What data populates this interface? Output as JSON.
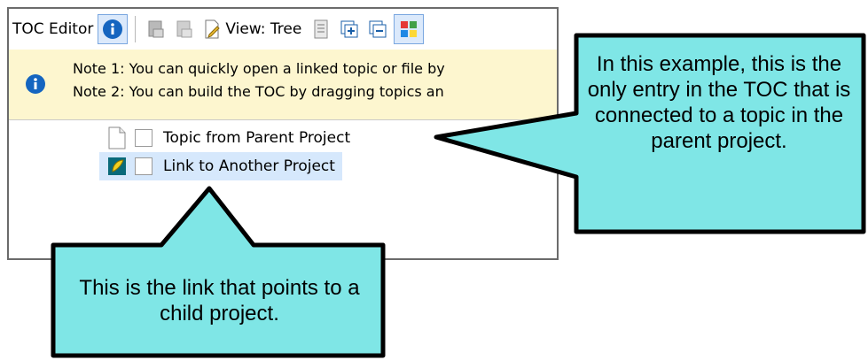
{
  "toolbar": {
    "title": "TOC Editor",
    "view_label": "View: Tree",
    "icons": [
      "info-icon",
      "book-icon",
      "book-disabled-icon",
      "edit-page-icon",
      "list-icon",
      "expand-all-icon",
      "collapse-all-icon",
      "grid-icon"
    ]
  },
  "notes": {
    "line1": "Note 1: You can quickly open a linked topic or file by",
    "line2": "Note 2: You can build the TOC by dragging topics an"
  },
  "tree": {
    "items": [
      {
        "label": "Topic from Parent  Project",
        "icon": "page-icon"
      },
      {
        "label": "Link to Another Project",
        "icon": "project-link-icon"
      }
    ]
  },
  "callouts": {
    "right": "In this example, this is the only entry in the TOC that is connected to a topic in the parent project.",
    "bottom": "This is the link that points to a child project."
  },
  "colors": {
    "callout_fill": "#7fe6e6",
    "notes_background": "#fdf6cf",
    "selection": "#d6e8fc",
    "info_blue": "#1565c0"
  }
}
